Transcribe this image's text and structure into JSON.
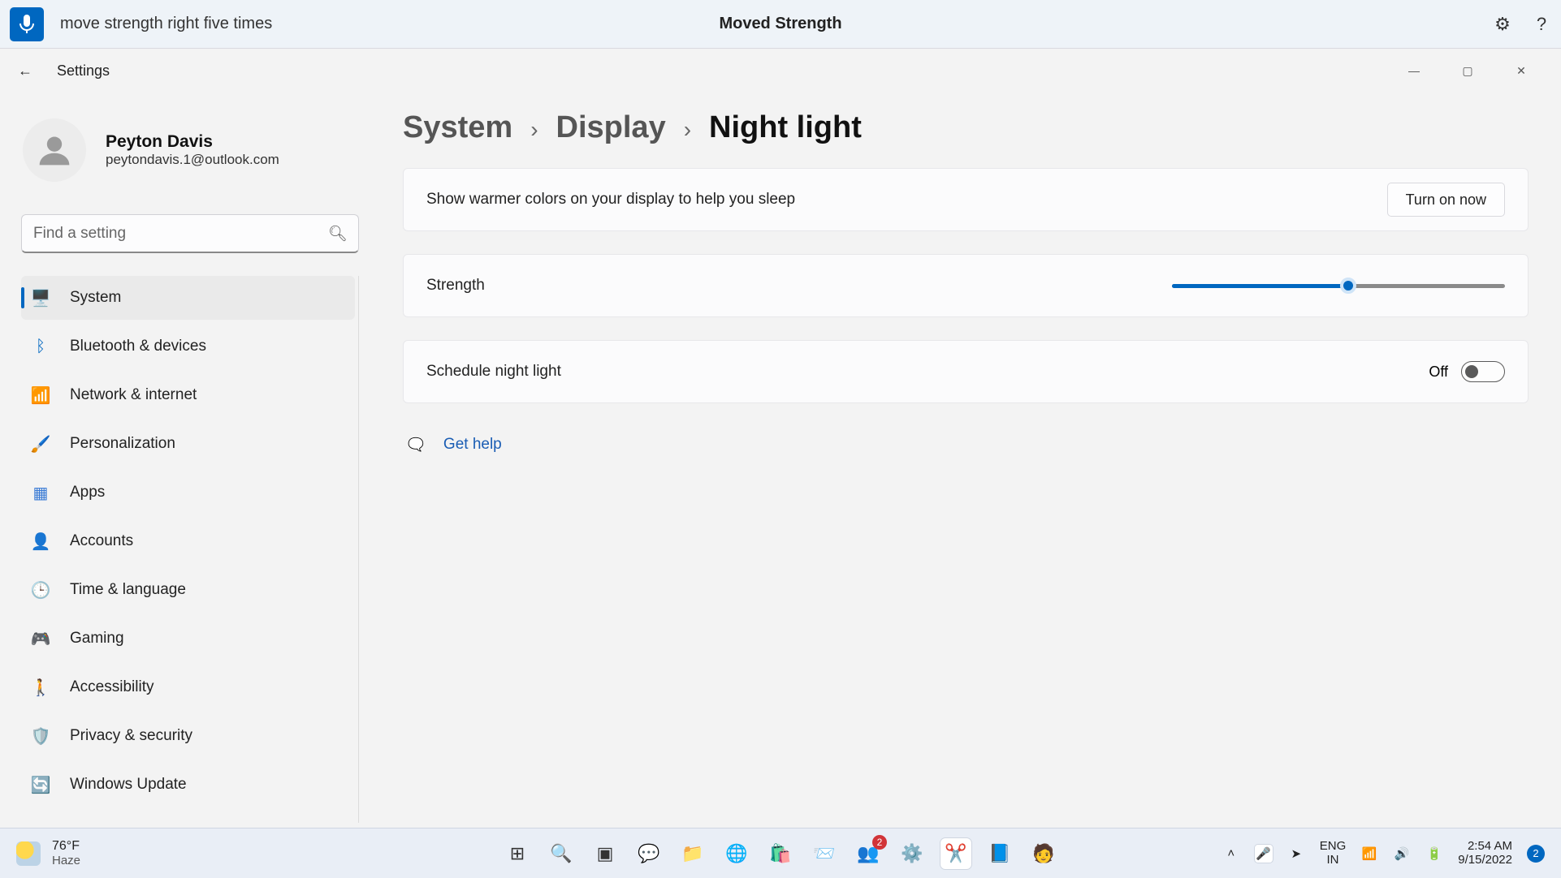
{
  "voicebar": {
    "command_text": "move strength right five times",
    "confirmation": "Moved Strength"
  },
  "window": {
    "app_title": "Settings"
  },
  "user": {
    "name": "Peyton Davis",
    "email": "peytondavis.1@outlook.com"
  },
  "search": {
    "placeholder": "Find a setting"
  },
  "sidebar": {
    "items": [
      {
        "label": "System",
        "selected": true,
        "icon": "🖥️",
        "color": "#0067c0"
      },
      {
        "label": "Bluetooth & devices",
        "selected": false,
        "icon": "ᛒ",
        "color": "#0067c0"
      },
      {
        "label": "Network & internet",
        "selected": false,
        "icon": "📶",
        "color": "#0067c0"
      },
      {
        "label": "Personalization",
        "selected": false,
        "icon": "🖌️",
        "color": "#c68b2f"
      },
      {
        "label": "Apps",
        "selected": false,
        "icon": "▦",
        "color": "#3a7bd5"
      },
      {
        "label": "Accounts",
        "selected": false,
        "icon": "👤",
        "color": "#2aa874"
      },
      {
        "label": "Time & language",
        "selected": false,
        "icon": "🕒",
        "color": "#3a7bd5"
      },
      {
        "label": "Gaming",
        "selected": false,
        "icon": "🎮",
        "color": "#888"
      },
      {
        "label": "Accessibility",
        "selected": false,
        "icon": "🚶",
        "color": "#0067c0"
      },
      {
        "label": "Privacy & security",
        "selected": false,
        "icon": "🛡️",
        "color": "#888"
      },
      {
        "label": "Windows Update",
        "selected": false,
        "icon": "🔄",
        "color": "#0067c0"
      }
    ]
  },
  "breadcrumb": {
    "a": "System",
    "b": "Display",
    "c": "Night light",
    "sep": "›"
  },
  "cards": {
    "desc": "Show warmer colors on your display to help you sleep",
    "turn_on_btn": "Turn on now",
    "strength_label": "Strength",
    "strength_value": 53,
    "schedule_label": "Schedule night light",
    "schedule_state_label": "Off",
    "schedule_state": false
  },
  "help": {
    "label": "Get help"
  },
  "taskbar": {
    "weather": {
      "temp": "76°F",
      "cond": "Haze"
    },
    "center": [
      {
        "name": "start-icon",
        "glyph": "⊞"
      },
      {
        "name": "search-icon",
        "glyph": "🔍"
      },
      {
        "name": "taskview-icon",
        "glyph": "▣"
      },
      {
        "name": "chat-icon",
        "glyph": "💬"
      },
      {
        "name": "explorer-icon",
        "glyph": "📁"
      },
      {
        "name": "edge-icon",
        "glyph": "🌐"
      },
      {
        "name": "store-icon",
        "glyph": "🛍️"
      },
      {
        "name": "mail-icon",
        "glyph": "📨"
      },
      {
        "name": "teams-icon",
        "glyph": "👥",
        "badge": "2"
      },
      {
        "name": "settings-icon",
        "glyph": "⚙️"
      },
      {
        "name": "snip-icon",
        "glyph": "✂️",
        "active": true
      },
      {
        "name": "word-icon",
        "glyph": "📘"
      },
      {
        "name": "people-icon",
        "glyph": "🧑"
      }
    ],
    "right": {
      "lang_top": "ENG",
      "lang_bottom": "IN",
      "time": "2:54 AM",
      "date": "9/15/2022",
      "notif_count": "2"
    }
  }
}
